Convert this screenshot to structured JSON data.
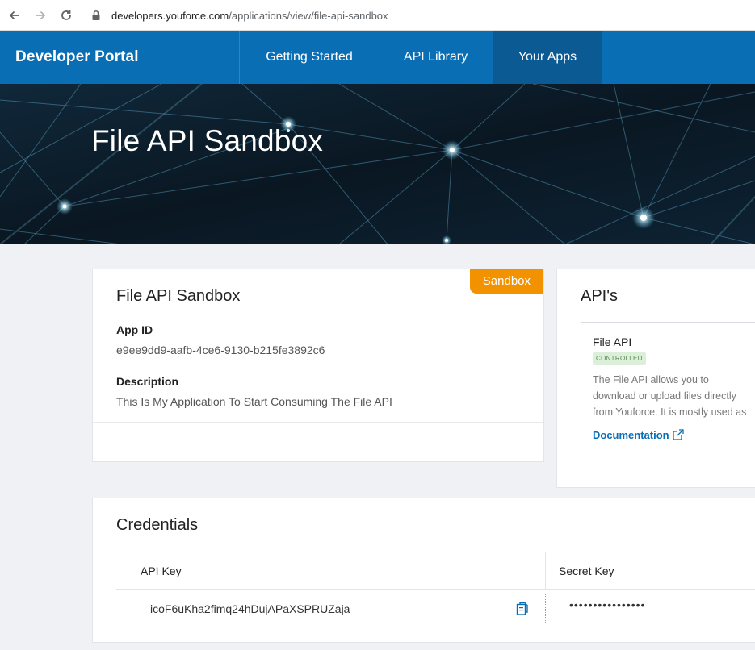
{
  "browser": {
    "url_host": "developers.youforce.com",
    "url_path": "/applications/view/file-api-sandbox"
  },
  "nav": {
    "brand": "Developer Portal",
    "items": [
      {
        "label": "Getting Started"
      },
      {
        "label": "API Library"
      },
      {
        "label": "Your Apps",
        "active": true
      }
    ]
  },
  "hero": {
    "title": "File API Sandbox"
  },
  "app": {
    "badge": "Sandbox",
    "title": "File API Sandbox",
    "app_id_label": "App ID",
    "app_id": "e9ee9dd9-aafb-4ce6-9130-b215fe3892c6",
    "description_label": "Description",
    "description": "This Is My Application To Start Consuming The File API"
  },
  "apis": {
    "title": "API's",
    "items": [
      {
        "name": "File API",
        "tag": "CONTROLLED",
        "description": "The File API allows you to download or upload files directly from Youforce. It is mostly used as",
        "link": "Documentation"
      }
    ]
  },
  "credentials": {
    "title": "Credentials",
    "api_key_label": "API Key",
    "secret_key_label": "Secret Key",
    "api_key": "icoF6uKha2fimq24hDujAPaXSPRUZaja",
    "secret_key": "••••••••••••••••"
  },
  "colors": {
    "nav_bg": "#0a6eb4",
    "nav_active": "#0c5a94",
    "badge": "#f39200",
    "link": "#0a6eb4"
  }
}
